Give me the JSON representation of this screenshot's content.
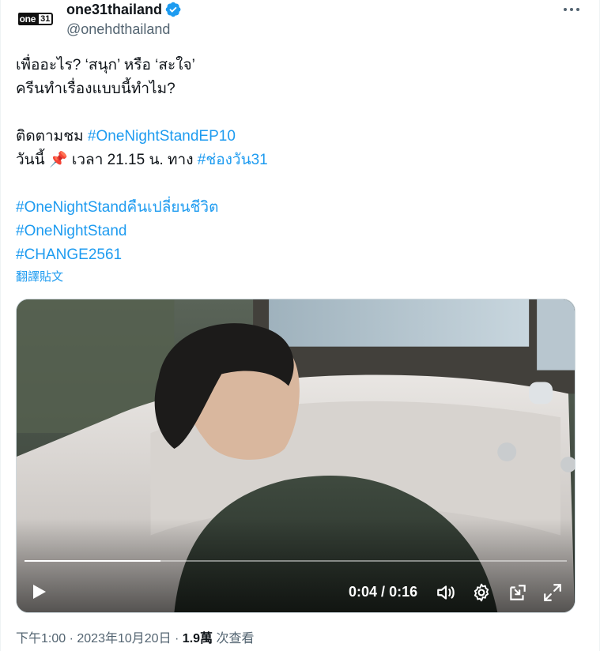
{
  "colors": {
    "accent": "#1d9bf0",
    "text": "#0f1419",
    "muted": "#536471",
    "verified": "#1d9bf0"
  },
  "header": {
    "avatar_logo_text": "one",
    "avatar_logo_num": "31",
    "display_name": "one31thailand",
    "handle": "@onehdthailand",
    "more_icon": "more-horizontal-icon",
    "verified_icon": "verified-badge-icon"
  },
  "tweet": {
    "line1": "เพื่ออะไร? ‘สนุก’ หรือ ‘สะใจ’",
    "line2": "ครีนทำเรื่องแบบนี้ทำไม?",
    "line4_text": "ติดตามชม ",
    "line4_hashtag": "#OneNightStandEP10",
    "line5_text_a": "วันนี้ ",
    "line5_pin": "📌",
    "line5_text_b": " เวลา 21.15 น. ทาง ",
    "line5_hashtag": "#ช่องวัน31",
    "hashtag1": "#OneNightStandคืนเปลี่ยนชีวิต",
    "hashtag2": "#OneNightStand",
    "hashtag3": "#CHANGE2561",
    "translate_label": "翻譯貼文"
  },
  "video": {
    "current_time": "0:04",
    "separator": "/",
    "duration": "0:16",
    "progress_fraction": 0.25,
    "controls": [
      "play-icon",
      "volume-icon",
      "settings-gear-icon",
      "pop-out-icon",
      "fullscreen-icon"
    ]
  },
  "meta": {
    "time": "下午1:00",
    "dot1": " · ",
    "date": "2023年10月20日",
    "dot2": " · ",
    "views": "1.9萬",
    "views_label": " 次查看"
  }
}
